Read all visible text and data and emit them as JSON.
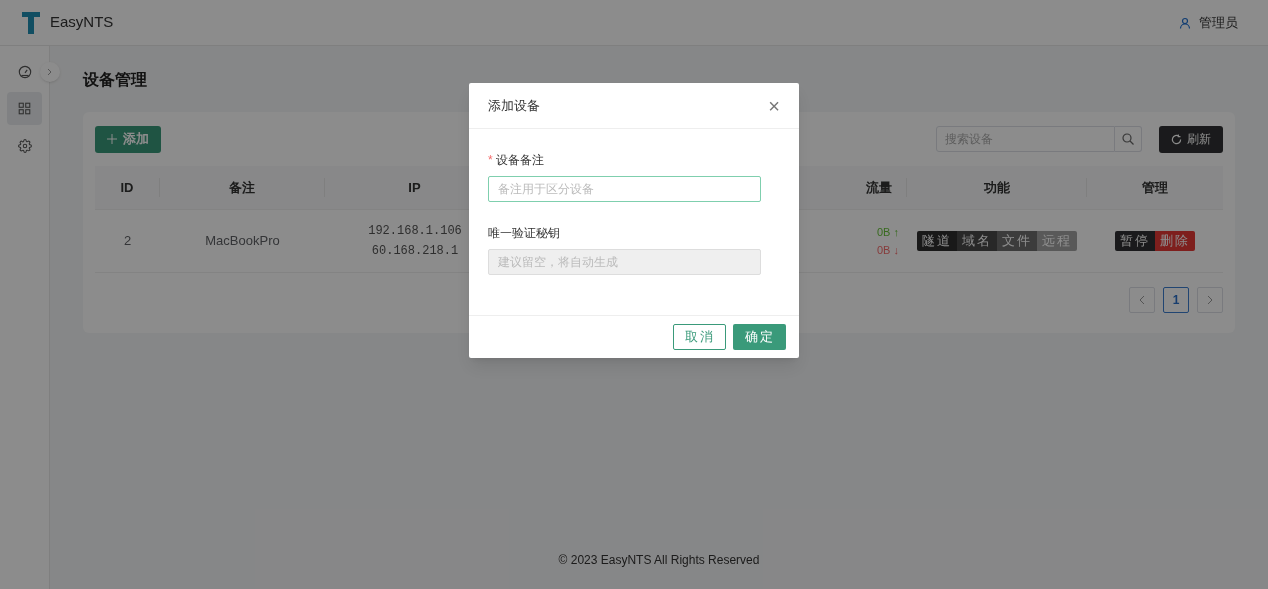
{
  "app": {
    "name": "EasyNTS",
    "user": "管理员"
  },
  "sidebar": {
    "items": [
      {
        "selected": false
      },
      {
        "selected": true
      },
      {
        "selected": false
      }
    ]
  },
  "page": {
    "title": "设备管理"
  },
  "toolbar": {
    "add_button": "添加",
    "search": {
      "placeholder": "搜索设备"
    },
    "refresh_button": "刷新"
  },
  "table": {
    "columns": [
      "ID",
      "备注",
      "IP",
      "流量",
      "功能",
      "管理"
    ],
    "rows": [
      {
        "id": "2",
        "note": "MacBookPro",
        "ip": [
          "192.168.1.106",
          "60.168.218.1"
        ],
        "traffic": {
          "up": "0B ↑",
          "down": "0B ↓"
        },
        "features": [
          "隧道",
          "域名",
          "文件",
          "远程"
        ],
        "manage": [
          {
            "label": "暂停",
            "kind": "pause"
          },
          {
            "label": "删除",
            "kind": "delete"
          }
        ]
      }
    ]
  },
  "pagination": {
    "pages": [
      {
        "label": "1",
        "selected": true
      }
    ]
  },
  "footer": "© 2023 EasyNTS All Rights Reserved",
  "dialog": {
    "title": "添加设备",
    "close": "×",
    "fields": [
      {
        "required_mark": "*",
        "label": "设备备注",
        "placeholder": "备注用于区分设备",
        "disabled": false,
        "focused": true
      },
      {
        "label": "唯一验证秘钥",
        "placeholder": "建议留空，将自动生成",
        "disabled": true,
        "focused": false
      }
    ],
    "buttons": [
      {
        "label": "取消",
        "kind": "secondary"
      },
      {
        "label": "确定",
        "kind": "primary"
      }
    ]
  }
}
